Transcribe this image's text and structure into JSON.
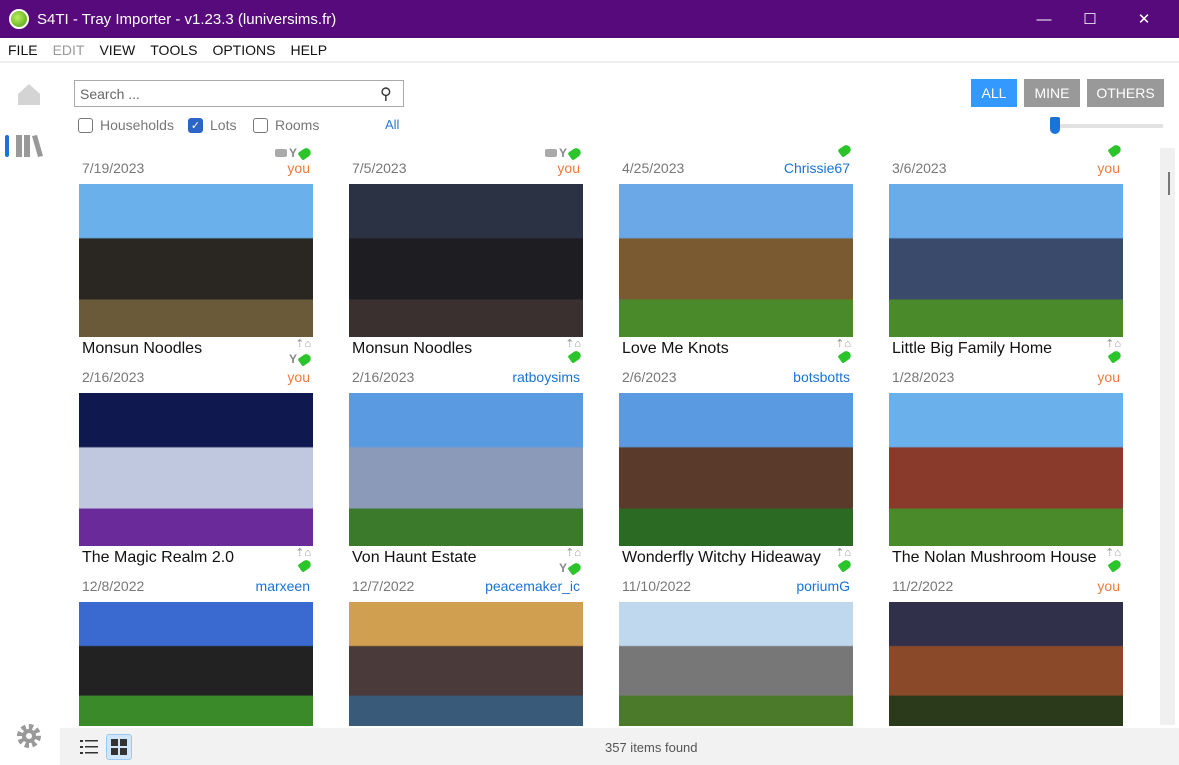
{
  "window": {
    "title": "S4TI - Tray Importer - v1.23.3  (luniversims.fr)",
    "minimize": "—",
    "maximize": "☐",
    "close": "✕"
  },
  "menu": [
    "FILE",
    "EDIT",
    "VIEW",
    "TOOLS",
    "OPTIONS",
    "HELP"
  ],
  "search": {
    "placeholder": "Search ..."
  },
  "filters": {
    "households": "Households",
    "lots": "Lots",
    "rooms": "Rooms",
    "all": "All",
    "households_checked": false,
    "lots_checked": true,
    "rooms_checked": false
  },
  "owner_buttons": {
    "all": "ALL",
    "mine": "MINE",
    "others": "OTHERS",
    "selected": "ALL"
  },
  "zoom_slider": {
    "value": 0.0
  },
  "colors": {
    "titlebar": "#560a7c",
    "accent": "#3399ff",
    "you": "#f07a3a",
    "author": "#1a73d6",
    "tag": "#2bc42b"
  },
  "cards": [
    {
      "title": "",
      "date": "7/19/2023",
      "author": "you",
      "icons": [
        "camera",
        "wrench",
        "tag"
      ],
      "img": [
        "#6aa8e8",
        "#2c2a24",
        "#4a7a30"
      ]
    },
    {
      "title": "",
      "date": "7/5/2023",
      "author": "you",
      "icons": [
        "camera",
        "wrench",
        "tag"
      ],
      "img": [
        "#3a4a66",
        "#222",
        "#2a4a22"
      ]
    },
    {
      "title": "",
      "date": "4/25/2023",
      "author": "Chrissie67",
      "icons": [
        "tag"
      ],
      "img": [
        "#5a9ae0",
        "#8a6a40",
        "#4a8a30"
      ]
    },
    {
      "title": "",
      "date": "3/6/2023",
      "author": "you",
      "icons": [
        "tag"
      ],
      "img": [
        "#5a9ae0",
        "#3a5a7a",
        "#4a8a30"
      ]
    },
    {
      "title": "Monsun Noodles",
      "date": "2/16/2023",
      "author": "you",
      "icons": [
        "lot",
        "wrench",
        "tag"
      ],
      "img": [
        "#6ab0ea",
        "#2a2622",
        "#6a5a3a"
      ]
    },
    {
      "title": "Monsun Noodles",
      "date": "2/16/2023",
      "author": "ratboysims",
      "icons": [
        "lot",
        "tag"
      ],
      "img": [
        "#2a3244",
        "#1e1e22",
        "#3a3030"
      ]
    },
    {
      "title": "Love Me Knots",
      "date": "2/6/2023",
      "author": "botsbotts",
      "icons": [
        "lot",
        "tag"
      ],
      "img": [
        "#6aa8e8",
        "#7a5a30",
        "#4a8a2a"
      ]
    },
    {
      "title": "Little Big Family Home",
      "date": "1/28/2023",
      "author": "you",
      "icons": [
        "lot",
        "tag"
      ],
      "img": [
        "#6aace8",
        "#3a4a6a",
        "#4a8a2a"
      ]
    },
    {
      "title": "The Magic Realm 2.0",
      "date": "12/8/2022",
      "author": "marxeen",
      "icons": [
        "lot",
        "tag"
      ],
      "img": [
        "#101850",
        "#c0c8e0",
        "#6a2a9a"
      ]
    },
    {
      "title": "Von Haunt Estate",
      "date": "12/7/2022",
      "author": "peacemaker_ic",
      "icons": [
        "lot",
        "wrench",
        "tag"
      ],
      "img": [
        "#5a9ae0",
        "#8a9ab8",
        "#3a7a2a"
      ]
    },
    {
      "title": "Wonderfly Witchy Hideaway",
      "date": "11/10/2022",
      "author": "poriumG",
      "icons": [
        "lot",
        "tag"
      ],
      "img": [
        "#5a9ae0",
        "#5a3a2a",
        "#2a6a22"
      ]
    },
    {
      "title": "The Nolan Mushroom House",
      "date": "11/2/2022",
      "author": "you",
      "icons": [
        "lot",
        "tag"
      ],
      "img": [
        "#6ab0ea",
        "#8a3a2a",
        "#4a8a2a"
      ]
    },
    {
      "title": "",
      "date": "",
      "author": "",
      "icons": [],
      "img": [
        "#3a6ad0",
        "#222",
        "#3a8a2a"
      ]
    },
    {
      "title": "",
      "date": "",
      "author": "",
      "icons": [],
      "img": [
        "#d0a050",
        "#4a3a3a",
        "#3a5a7a"
      ]
    },
    {
      "title": "",
      "date": "",
      "author": "",
      "icons": [],
      "img": [
        "#c0d8ee",
        "#777",
        "#4a7a2a"
      ]
    },
    {
      "title": "",
      "date": "",
      "author": "",
      "icons": [],
      "img": [
        "#30304a",
        "#8a4a2a",
        "#2a3a1a"
      ]
    }
  ],
  "status": {
    "items_found": "357 items found",
    "view_mode": "grid"
  }
}
